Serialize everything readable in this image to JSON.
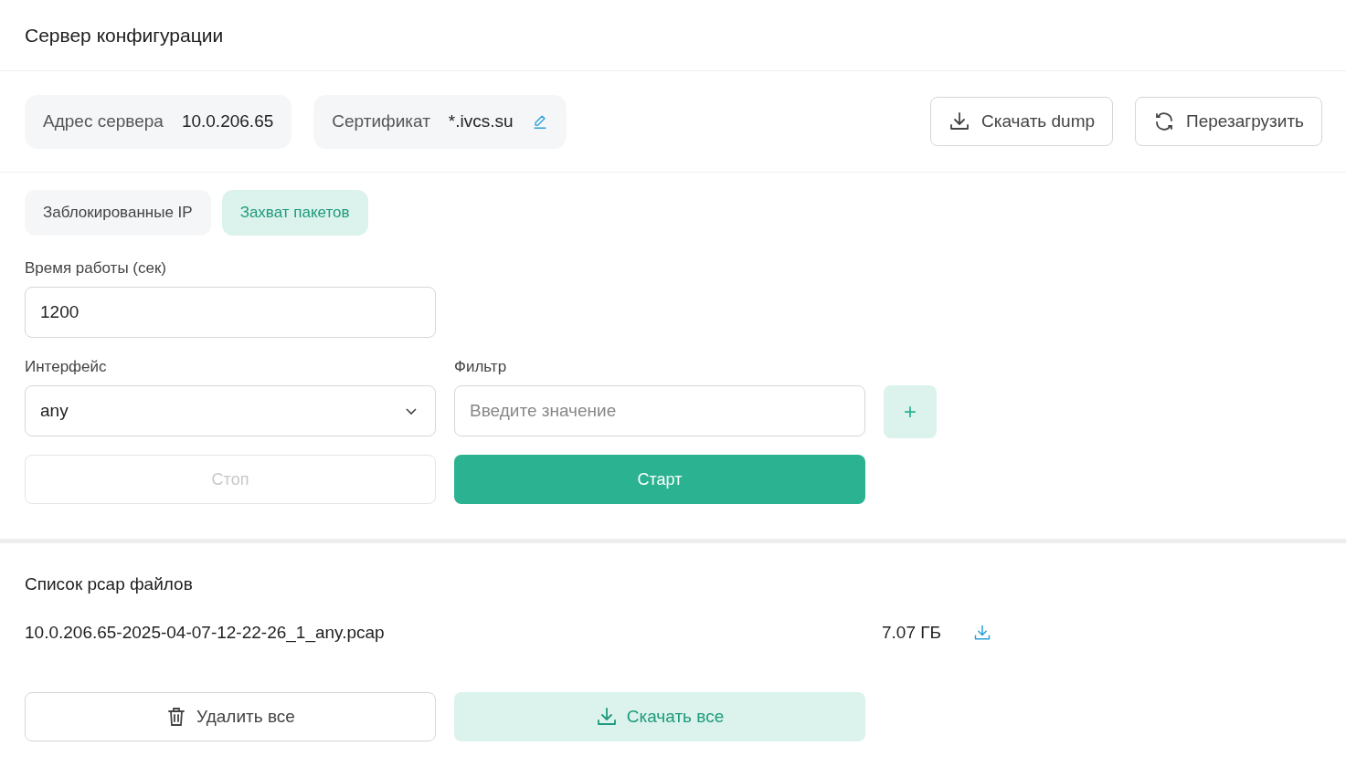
{
  "page": {
    "title": "Сервер конфигурации"
  },
  "server_info": [
    {
      "label": "Адрес сервера",
      "value": "10.0.206.65",
      "editable": false
    },
    {
      "label": "Сертификат",
      "value": "*.ivcs.su",
      "editable": true
    }
  ],
  "header_actions": [
    {
      "kind": "download",
      "label": "Скачать dump"
    },
    {
      "kind": "reload",
      "label": "Перезагрузить"
    }
  ],
  "tabs": [
    {
      "label": "Заблокированные IP",
      "selected": false
    },
    {
      "label": "Захват пакетов",
      "selected": true
    }
  ],
  "capture": {
    "duration": {
      "label": "Время работы (сек)",
      "value": "1200"
    },
    "interface": {
      "label": "Интерфейс",
      "value": "any"
    },
    "filter": {
      "label": "Фильтр",
      "placeholder": "Введите значение",
      "add_label": "+"
    },
    "stop": {
      "label": "Стоп",
      "disabled": true
    },
    "start": {
      "label": "Старт",
      "disabled": false
    }
  },
  "pcap": {
    "title": "Список pcap файлов",
    "files": [
      {
        "name": "10.0.206.65-2025-04-07-12-22-26_1_any.pcap",
        "size": "7.07 ГБ"
      }
    ],
    "actions": [
      {
        "kind": "delete",
        "label": "Удалить все"
      },
      {
        "kind": "download",
        "label": "Скачать все"
      }
    ]
  }
}
